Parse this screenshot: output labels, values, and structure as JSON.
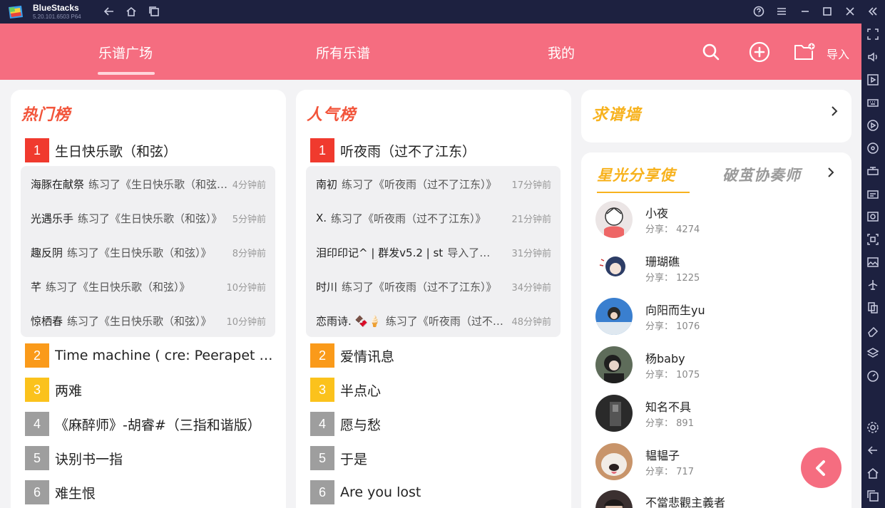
{
  "window": {
    "app_name": "BlueStacks",
    "version": "5.20.101.6503 P64"
  },
  "nav": {
    "tabs": [
      {
        "label": "乐谱广场",
        "active": true
      },
      {
        "label": "所有乐谱",
        "active": false
      },
      {
        "label": "我的",
        "active": false
      }
    ],
    "import_label": "导入"
  },
  "hot": {
    "title": "热门榜",
    "first": {
      "rank": "1",
      "title": "生日快乐歌（和弦）"
    },
    "activity": [
      {
        "user": "海豚在献祭",
        "text": "练习了《生日快乐歌（和弦）》",
        "time": "4分钟前"
      },
      {
        "user": "光遇乐手",
        "text": "练习了《生日快乐歌（和弦）》",
        "time": "5分钟前"
      },
      {
        "user": "趣反阴",
        "text": "练习了《生日快乐歌（和弦）》",
        "time": "8分钟前"
      },
      {
        "user": "芊",
        "text": "练习了《生日快乐歌（和弦）》",
        "time": "10分钟前"
      },
      {
        "user": "惊栖春",
        "text": "练习了《生日快乐歌（和弦）》",
        "time": "10分钟前"
      }
    ],
    "items": [
      {
        "rank": "2",
        "title": "Time machine ( cre: Peerapet Se..."
      },
      {
        "rank": "3",
        "title": "两难"
      },
      {
        "rank": "4",
        "title": "《麻醉师》-胡睿#（三指和谐版）"
      },
      {
        "rank": "5",
        "title": "诀别书一指"
      },
      {
        "rank": "6",
        "title": "难生恨"
      }
    ]
  },
  "popular": {
    "title": "人气榜",
    "first": {
      "rank": "1",
      "title": "听夜雨（过不了江东）"
    },
    "activity": [
      {
        "user": "南初",
        "text": "练习了《听夜雨（过不了江东）》",
        "time": "17分钟前"
      },
      {
        "user": "X.",
        "text": "练习了《听夜雨（过不了江东）》",
        "time": "21分钟前"
      },
      {
        "user": "泪印印记^ | 群发v5.2 | st",
        "text": "导入了…",
        "time": "31分钟前"
      },
      {
        "user": "时川",
        "text": "练习了《听夜雨（过不了江东）》",
        "time": "34分钟前"
      },
      {
        "user": "恋雨诗. 🍫🍦",
        "text": "练习了《听夜雨（过不了江东）》",
        "time": "48分钟前"
      }
    ],
    "items": [
      {
        "rank": "2",
        "title": "爱情讯息"
      },
      {
        "rank": "3",
        "title": "半点心"
      },
      {
        "rank": "4",
        "title": "愿与愁"
      },
      {
        "rank": "5",
        "title": "于是"
      },
      {
        "rank": "6",
        "title": "Are you lost"
      }
    ]
  },
  "request_wall": {
    "title": "求谱墙"
  },
  "sharers": {
    "tab_active": "星光分享使",
    "tab_inactive": "破茧协奏师",
    "share_label": "分享：",
    "users": [
      {
        "name": "小夜",
        "shares": "4274",
        "avatar_color": "#e9e2e2"
      },
      {
        "name": "珊瑚礁",
        "shares": "1225",
        "avatar_color": "#2d3d66"
      },
      {
        "name": "向阳而生yu",
        "shares": "1076",
        "avatar_color": "#3a7fcf"
      },
      {
        "name": "杨baby",
        "shares": "1075",
        "avatar_color": "#5e6c5a"
      },
      {
        "name": "知名不具",
        "shares": "891",
        "avatar_color": "#2a2a2a"
      },
      {
        "name": "韫韫子",
        "shares": "717",
        "avatar_color": "#c8946a"
      },
      {
        "name": "不當悲觀主義者",
        "shares": "",
        "avatar_color": "#3b3030"
      }
    ]
  }
}
